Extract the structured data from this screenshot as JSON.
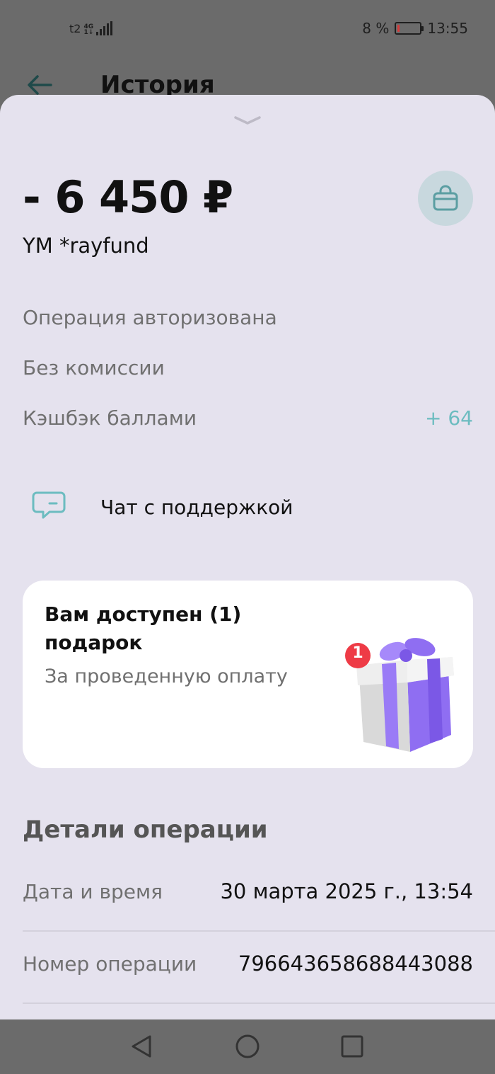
{
  "status_bar": {
    "carrier": "t2",
    "network_top": "4G",
    "network_bottom": "1↓",
    "battery_percent": "8 %",
    "battery_level": 0.08,
    "time": "13:55"
  },
  "background_header": {
    "back_icon": "arrow-left-icon",
    "title": "История"
  },
  "sheet": {
    "handle_icon": "chevron-down-icon",
    "amount": "- 6 450 ₽",
    "merchant": "YM *rayfund",
    "category_icon": "shopping-bag-icon",
    "status": "Операция авторизована",
    "commission": "Без комиссии",
    "cashback_label": "Кэшбэк баллами",
    "cashback_value": "+ 64",
    "support_icon": "chat-bubble-icon",
    "support_label": "Чат с поддержкой",
    "gift": {
      "title": "Вам доступен (1) подарок",
      "subtitle": "За проведенную оплату",
      "badge": "1",
      "image_icon": "gift-box-icon"
    },
    "details": {
      "title": "Детали операции",
      "rows": [
        {
          "label": "Дата и время",
          "value": "30 марта 2025 г., 13:54"
        },
        {
          "label": "Номер операции",
          "value": "79664365868844308​8"
        }
      ]
    }
  },
  "nav_bar": {
    "back": "triangle-back-icon",
    "home": "circle-home-icon",
    "recents": "square-recents-icon"
  },
  "colors": {
    "accent": "#6cbcc0",
    "sheet_bg": "#e5e2ee",
    "gift_purple": "#8f6ef2",
    "badge_red": "#ee3b46"
  }
}
